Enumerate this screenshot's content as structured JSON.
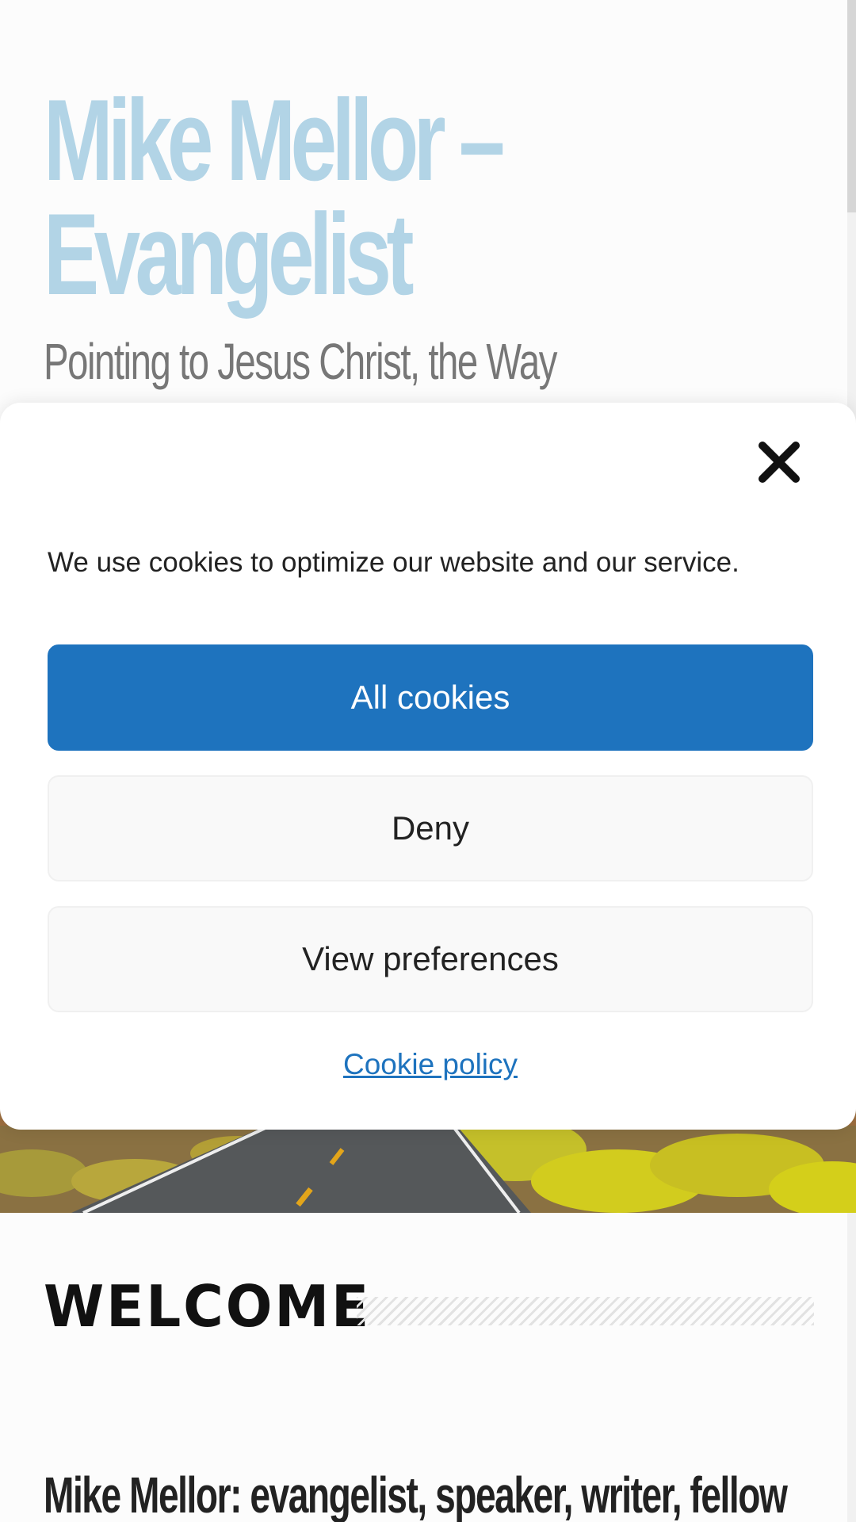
{
  "site": {
    "title_line1": "Mike Mellor –",
    "title_line2": "Evangelist",
    "tagline": "Pointing to Jesus Christ, the Way"
  },
  "cookie_banner": {
    "message": "We use cookies to optimize our website and our service.",
    "accept_label": "All cookies",
    "deny_label": "Deny",
    "preferences_label": "View preferences",
    "policy_link": "Cookie policy",
    "close_icon": "close-icon",
    "accent_color": "#1e73be"
  },
  "welcome": {
    "heading": "WELCOME"
  },
  "post": {
    "heading": "Mike Mellor: evangelist, speaker, writer, fellow"
  },
  "colors": {
    "title": "#b2d4e6",
    "tagline": "#777777",
    "button_primary": "#1e73be",
    "link": "#1e73be"
  }
}
